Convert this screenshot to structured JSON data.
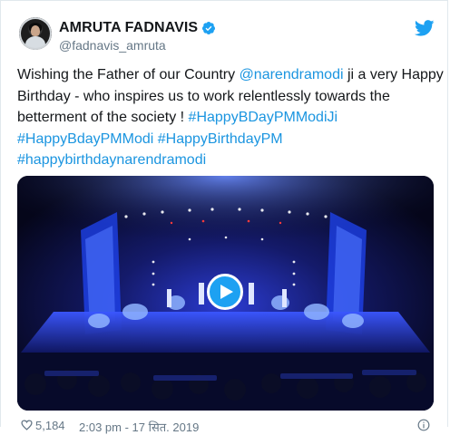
{
  "tweet": {
    "author": {
      "display_name": "AMRUTA FADNAVIS",
      "handle": "@fadnavis_amruta",
      "verified": true
    },
    "text_parts": {
      "p1": "Wishing the Father of our Country ",
      "mention": "@narendramodi",
      "p2": " ji a very Happy Birthday - who inspires us to work relentlessly towards the betterment of the society ! ",
      "hashtag1": "#HappyBDayPMModiJi",
      "hashtag2": "#HappyBdayPMModi",
      "hashtag3": "#HappyBirthdayPM",
      "hashtag4": "#happybirthdaynarendramodi"
    },
    "media": {
      "type": "video",
      "play_icon": "play-icon"
    },
    "footer": {
      "likes": "5,184",
      "time": "2:03 pm - 17 सित. 2019",
      "info_icon": "info-icon"
    },
    "brand_icon": "twitter-bird-icon"
  },
  "colors": {
    "link": "#1b95e0",
    "text": "#14171a",
    "muted": "#657786",
    "twitter_blue": "#1da1f2"
  }
}
